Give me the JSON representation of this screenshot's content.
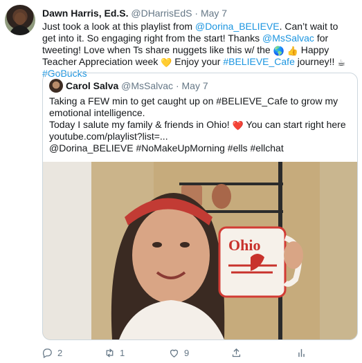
{
  "tweet": {
    "author_name": "Dawn Harris, Ed.S.",
    "handle": "@DHarrisEdS",
    "sep": "·",
    "date": "May 7",
    "body_parts": [
      "Just took a look at this playlist from ",
      "@Dorina_BELIEVE",
      ". Can’t wait to get into it. So engaging right from the start! Thanks ",
      "@MsSalvac",
      " for tweeting! Love when Ts share nuggets like this w/ the ",
      " ",
      " Happy Teacher Appreciation week ",
      " Enjoy your ",
      "#BELIEVE_Cafe",
      " journey!! ",
      "#GoBucks"
    ],
    "emoji": {
      "globe": "🌎",
      "thumb": "👍",
      "heart": "💛",
      "coffee": "☕"
    }
  },
  "quoted": {
    "author_name": "Carol Salva",
    "handle": "@MsSalvac",
    "sep": "·",
    "date": "May 7",
    "line1": "Taking a FEW min to get caught up on #BELIEVE_Cafe to grow my emotional intelligence.",
    "line2a": "Today I salute my family & friends in Ohio!",
    "heart_emoji": "❤️",
    "line2b": " You can start right here youtube.com/playlist?list=...",
    "line3": "@Dorina_BELIEVE #NoMakeUpMorning #ells #ellchat",
    "mug_text": "Ohio"
  },
  "actions": {
    "reply_count": "2",
    "retweet_count": "1",
    "like_count": "9"
  },
  "colors": {
    "accent": "#1b95e0",
    "muted": "#657786",
    "border": "#ccd6dd"
  }
}
